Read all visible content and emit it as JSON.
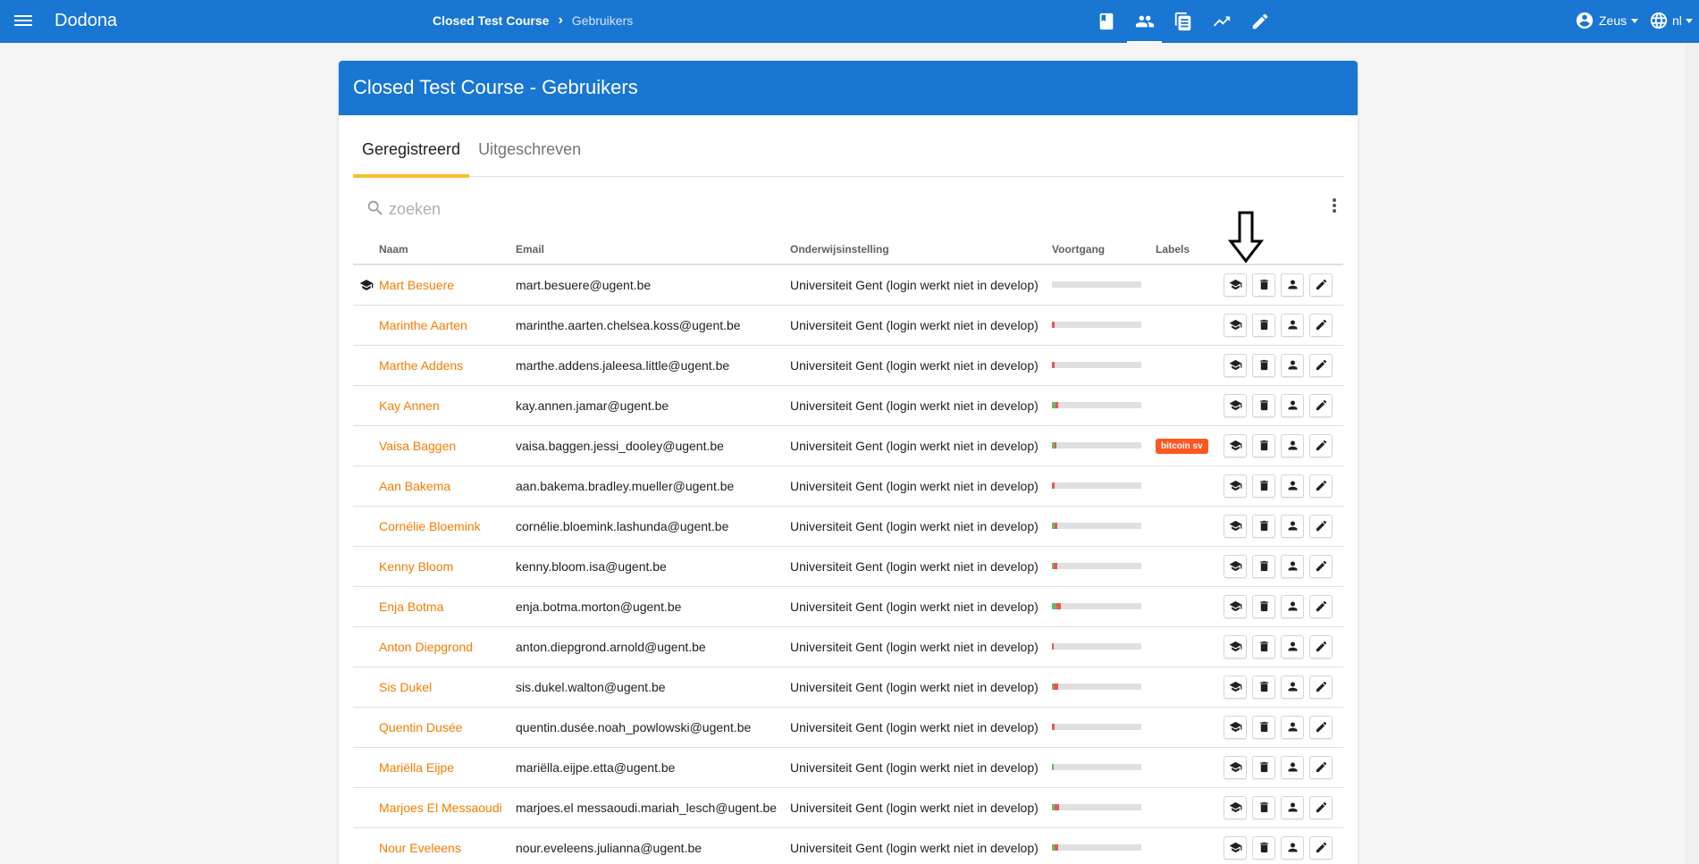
{
  "topbar": {
    "brand": "Dodona",
    "breadcrumb": {
      "course": "Closed Test Course",
      "current": "Gebruikers"
    },
    "nav_icons": [
      "book-icon",
      "people-icon",
      "document-icon",
      "trending-up-icon",
      "pencil-icon"
    ],
    "active_nav": "people-icon",
    "user": "Zeus",
    "language": "nl"
  },
  "card": {
    "title": "Closed Test Course - Gebruikers",
    "tabs": [
      {
        "label": "Geregistreerd",
        "active": true
      },
      {
        "label": "Uitgeschreven",
        "active": false
      }
    ],
    "search": {
      "placeholder": "zoeken",
      "value": ""
    },
    "columns": {
      "name": "Naam",
      "email": "Email",
      "institution": "Onderwijsinstelling",
      "progress": "Voortgang",
      "labels": "Labels"
    },
    "rows": [
      {
        "name": "Mart Besuere",
        "email": "mart.besuere@ugent.be",
        "institution": "Universiteit Gent (login werkt niet in develop)",
        "course_admin": true,
        "progress_correct": 0,
        "progress_wrong": 0,
        "label": ""
      },
      {
        "name": "Marinthe Aarten",
        "email": "marinthe.aarten.chelsea.koss@ugent.be",
        "institution": "Universiteit Gent (login werkt niet in develop)",
        "course_admin": false,
        "progress_correct": 0,
        "progress_wrong": 0.03,
        "label": ""
      },
      {
        "name": "Marthe Addens",
        "email": "marthe.addens.jaleesa.little@ugent.be",
        "institution": "Universiteit Gent (login werkt niet in develop)",
        "course_admin": false,
        "progress_correct": 0,
        "progress_wrong": 0.03,
        "label": ""
      },
      {
        "name": "Kay Annen",
        "email": "kay.annen.jamar@ugent.be",
        "institution": "Universiteit Gent (login werkt niet in develop)",
        "course_admin": false,
        "progress_correct": 0.04,
        "progress_wrong": 0.03,
        "label": ""
      },
      {
        "name": "Vaisa Baggen",
        "email": "vaisa.baggen.jessi_dooley@ugent.be",
        "institution": "Universiteit Gent (login werkt niet in develop)",
        "course_admin": false,
        "progress_correct": 0.03,
        "progress_wrong": 0.02,
        "label": "bitcoin sv"
      },
      {
        "name": "Aan Bakema",
        "email": "aan.bakema.bradley.mueller@ugent.be",
        "institution": "Universiteit Gent (login werkt niet in develop)",
        "course_admin": false,
        "progress_correct": 0,
        "progress_wrong": 0.03,
        "label": ""
      },
      {
        "name": "Cornélie Bloemink",
        "email": "cornélie.bloemink.lashunda@ugent.be",
        "institution": "Universiteit Gent (login werkt niet in develop)",
        "course_admin": false,
        "progress_correct": 0.03,
        "progress_wrong": 0.03,
        "label": ""
      },
      {
        "name": "Kenny Bloom",
        "email": "kenny.bloom.isa@ugent.be",
        "institution": "Universiteit Gent (login werkt niet in develop)",
        "course_admin": false,
        "progress_correct": 0.02,
        "progress_wrong": 0.04,
        "label": ""
      },
      {
        "name": "Enja Botma",
        "email": "enja.botma.morton@ugent.be",
        "institution": "Universiteit Gent (login werkt niet in develop)",
        "course_admin": false,
        "progress_correct": 0.05,
        "progress_wrong": 0.05,
        "label": ""
      },
      {
        "name": "Anton Diepgrond",
        "email": "anton.diepgrond.arnold@ugent.be",
        "institution": "Universiteit Gent (login werkt niet in develop)",
        "course_admin": false,
        "progress_correct": 0,
        "progress_wrong": 0.02,
        "label": ""
      },
      {
        "name": "Sis Dukel",
        "email": "sis.dukel.walton@ugent.be",
        "institution": "Universiteit Gent (login werkt niet in develop)",
        "course_admin": false,
        "progress_correct": 0.02,
        "progress_wrong": 0.05,
        "label": ""
      },
      {
        "name": "Quentin Dusée",
        "email": "quentin.dusée.noah_powlowski@ugent.be",
        "institution": "Universiteit Gent (login werkt niet in develop)",
        "course_admin": false,
        "progress_correct": 0,
        "progress_wrong": 0.03,
        "label": ""
      },
      {
        "name": "Mariëlla Eijpe",
        "email": "mariëlla.eijpe.etta@ugent.be",
        "institution": "Universiteit Gent (login werkt niet in develop)",
        "course_admin": false,
        "progress_correct": 0.02,
        "progress_wrong": 0,
        "label": ""
      },
      {
        "name": "Marjoes El Messaoudi",
        "email": "marjoes.el messaoudi.mariah_lesch@ugent.be",
        "institution": "Universiteit Gent (login werkt niet in develop)",
        "course_admin": false,
        "progress_correct": 0.03,
        "progress_wrong": 0.05,
        "label": ""
      },
      {
        "name": "Nour Eveleens",
        "email": "nour.eveleens.julianna@ugent.be",
        "institution": "Universiteit Gent (login werkt niet in develop)",
        "course_admin": false,
        "progress_correct": 0.03,
        "progress_wrong": 0.04,
        "label": ""
      }
    ]
  },
  "colors": {
    "primary": "#1976d2",
    "tab_indicator": "#fbc02d",
    "name_link": "#f57c00",
    "label_chip": "#ff5722",
    "progress_correct": "#66bb6a",
    "progress_wrong": "#ef5350"
  }
}
